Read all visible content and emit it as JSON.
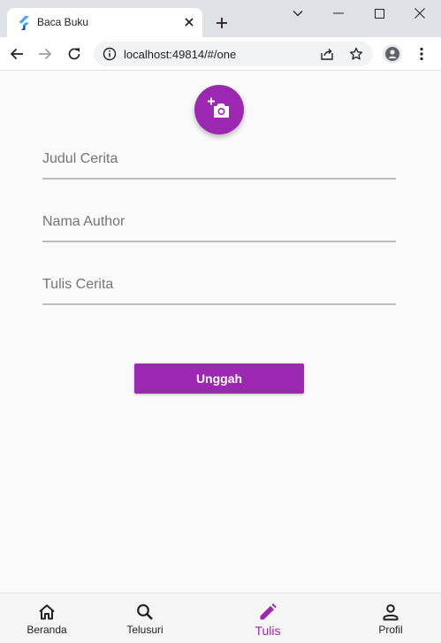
{
  "browser": {
    "tab_title": "Baca Buku",
    "url": "localhost:49814/#/one"
  },
  "form": {
    "title_placeholder": "Judul Cerita",
    "author_placeholder": "Nama Author",
    "story_placeholder": "Tulis Cerita",
    "submit_label": "Unggah"
  },
  "bottom_nav": {
    "items": [
      {
        "label": "Beranda",
        "icon": "home-icon"
      },
      {
        "label": "Telusuri",
        "icon": "search-icon"
      },
      {
        "label": "Tulis",
        "icon": "edit-icon",
        "active": true
      },
      {
        "label": "Profil",
        "icon": "person-icon"
      }
    ]
  },
  "colors": {
    "accent": "#9c27b0",
    "background": "#fafafa"
  }
}
